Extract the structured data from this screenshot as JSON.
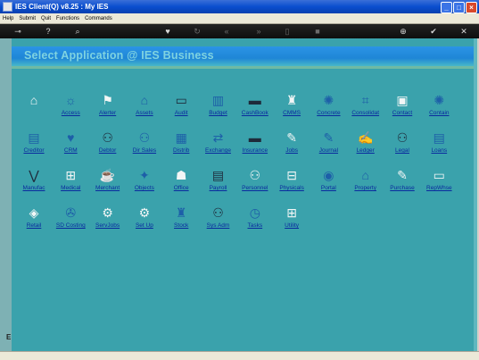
{
  "window": {
    "title": "IES Client(Q) v8.25 : My IES"
  },
  "menu": [
    "Help",
    "Submit",
    "Quit",
    "Functions",
    "Commands"
  ],
  "toolbar": [
    {
      "icon": "key-icon"
    },
    {
      "icon": "help-icon"
    },
    {
      "icon": "search-icon"
    },
    {
      "icon": "favorite-icon"
    },
    {
      "icon": "refresh-icon"
    },
    {
      "icon": "rewind-icon"
    },
    {
      "icon": "forward-icon"
    },
    {
      "icon": "clipboard-icon"
    },
    {
      "icon": "stop-icon"
    },
    {
      "icon": "add-icon"
    },
    {
      "icon": "ok-icon"
    },
    {
      "icon": "close-icon"
    }
  ],
  "sidebar": {
    "mark": "E"
  },
  "banner": {
    "title": "Select Application @ IES Business"
  },
  "apps": [
    {
      "label": "",
      "icon": "home-icon"
    },
    {
      "label": "Access",
      "icon": "access-icon"
    },
    {
      "label": "Alerter",
      "icon": "alerter-icon"
    },
    {
      "label": "Assets",
      "icon": "assets-icon"
    },
    {
      "label": "Audit",
      "icon": "audit-icon"
    },
    {
      "label": "Budget",
      "icon": "budget-icon"
    },
    {
      "label": "CashBook",
      "icon": "cashbook-icon"
    },
    {
      "label": "CMMS",
      "icon": "cmms-icon"
    },
    {
      "label": "Concrete",
      "icon": "concrete-icon"
    },
    {
      "label": "Consolidat",
      "icon": "consolidat-icon"
    },
    {
      "label": "Contact",
      "icon": "contact-icon"
    },
    {
      "label": "Contain",
      "icon": "contain-icon"
    },
    {
      "label": "Creditor",
      "icon": "creditor-icon"
    },
    {
      "label": "CRM",
      "icon": "crm-icon"
    },
    {
      "label": "Debtor",
      "icon": "debtor-icon"
    },
    {
      "label": "Dir Sales",
      "icon": "dir-sales-icon"
    },
    {
      "label": "Distrib",
      "icon": "distrib-icon"
    },
    {
      "label": "Exchange",
      "icon": "exchange-icon"
    },
    {
      "label": "Insurance",
      "icon": "insurance-icon"
    },
    {
      "label": "Jobs",
      "icon": "jobs-icon"
    },
    {
      "label": "Journal",
      "icon": "journal-icon"
    },
    {
      "label": "Ledger",
      "icon": "ledger-icon"
    },
    {
      "label": "Legal",
      "icon": "legal-icon"
    },
    {
      "label": "Loans",
      "icon": "loans-icon"
    },
    {
      "label": "Manufac",
      "icon": "manufac-icon"
    },
    {
      "label": "Medical",
      "icon": "medical-icon"
    },
    {
      "label": "Merchant",
      "icon": "merchant-icon"
    },
    {
      "label": "Objects",
      "icon": "objects-icon"
    },
    {
      "label": "Office",
      "icon": "office-icon"
    },
    {
      "label": "Payroll",
      "icon": "payroll-icon"
    },
    {
      "label": "Personnel",
      "icon": "personnel-icon"
    },
    {
      "label": "Physicals",
      "icon": "physicals-icon"
    },
    {
      "label": "Portal",
      "icon": "portal-icon"
    },
    {
      "label": "Property",
      "icon": "property-icon"
    },
    {
      "label": "Purchase",
      "icon": "purchase-icon"
    },
    {
      "label": "RepWhse",
      "icon": "repwhse-icon"
    },
    {
      "label": "Retail",
      "icon": "retail-icon"
    },
    {
      "label": "SD Costing",
      "icon": "sd-costing-icon"
    },
    {
      "label": "ServJobs",
      "icon": "servjobs-icon"
    },
    {
      "label": "Set Up",
      "icon": "set-up-icon"
    },
    {
      "label": "Stock",
      "icon": "stock-icon"
    },
    {
      "label": "Sys Adm",
      "icon": "sys-adm-icon"
    },
    {
      "label": "Tasks",
      "icon": "tasks-icon"
    },
    {
      "label": "Utility",
      "icon": "utility-icon"
    }
  ]
}
